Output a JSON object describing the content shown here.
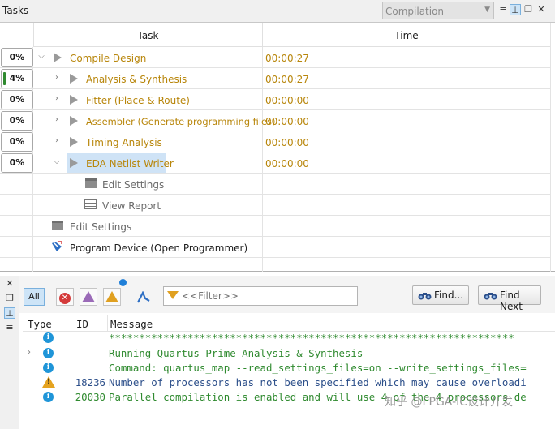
{
  "tasks_panel": {
    "title": "Tasks",
    "flow": "Compilation",
    "columns": {
      "task": "Task",
      "time": "Time"
    }
  },
  "task_rows": [
    {
      "pct": "0%",
      "progress": 0,
      "label": "Compile Design",
      "time": "00:00:27"
    },
    {
      "pct": "4%",
      "progress": 0.04,
      "label": "Analysis & Synthesis",
      "time": "00:00:27"
    },
    {
      "pct": "0%",
      "progress": 0,
      "label": "Fitter (Place & Route)",
      "time": "00:00:00"
    },
    {
      "pct": "0%",
      "progress": 0,
      "label": "Assembler (Generate programming files)",
      "time": "00:00:00"
    },
    {
      "pct": "0%",
      "progress": 0,
      "label": "Timing Analysis",
      "time": "00:00:00"
    },
    {
      "pct": "0%",
      "progress": 0,
      "label": "EDA Netlist Writer",
      "time": "00:00:00"
    }
  ],
  "sub_items": {
    "edit_settings_nested": "Edit Settings",
    "view_report": "View Report",
    "edit_settings": "Edit Settings",
    "program_device": "Program Device (Open Programmer)"
  },
  "messages_panel": {
    "all_label": "All",
    "filter_placeholder": "<<Filter>>",
    "find_label": "Find...",
    "find_next_label": "Find Next",
    "columns": {
      "type": "Type",
      "id": "ID",
      "message": "Message"
    }
  },
  "messages": [
    {
      "type": "info",
      "id": "",
      "text": "*******************************************************************"
    },
    {
      "type": "info",
      "id": "",
      "text": "Running Quartus Prime Analysis & Synthesis"
    },
    {
      "type": "info",
      "id": "",
      "text": "Command: quartus_map --read_settings_files=on --write_settings_files="
    },
    {
      "type": "warning",
      "id": "18236",
      "text": "Number of processors has not been specified which may cause overloadi"
    },
    {
      "type": "info",
      "id": "20030",
      "text": "Parallel compilation is enabled and will use 4 of the 4 processors de"
    }
  ],
  "watermark": "知乎 @FPGA-IC设计开发",
  "colors": {
    "task_text": "#b8860b",
    "message_text": "#2f8a2f",
    "progress_fill": "#2f8a2f",
    "info": "#1f95d8",
    "warning": "#e5a31f"
  }
}
